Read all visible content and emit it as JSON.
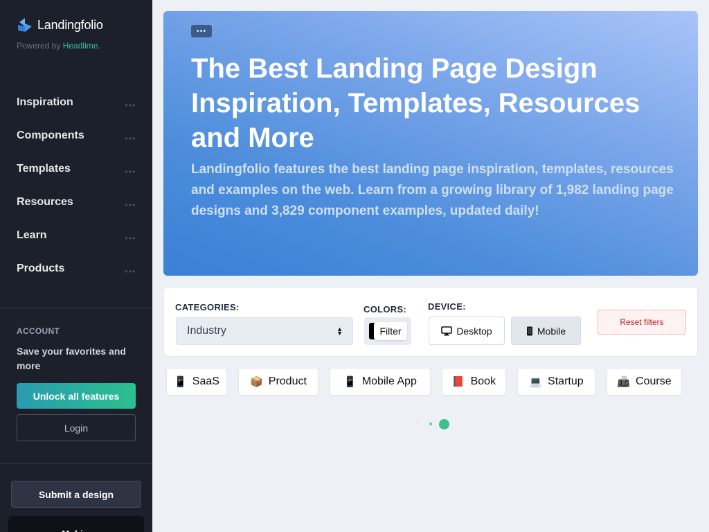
{
  "brand": {
    "name": "Landingfolio",
    "powered_prefix": "Powered by",
    "powered_name": "Headlime."
  },
  "nav": {
    "items": [
      {
        "label": "Inspiration",
        "more": "•••"
      },
      {
        "label": "Components",
        "more": "•••"
      },
      {
        "label": "Templates",
        "more": "•••"
      },
      {
        "label": "Resources",
        "more": "•••"
      },
      {
        "label": "Learn",
        "more": "•••"
      },
      {
        "label": "Products",
        "more": "•••"
      }
    ]
  },
  "account": {
    "title": "ACCOUNT",
    "description": "Save your favorites and more",
    "unlock_label": "Unlock all features",
    "login_label": "Login"
  },
  "submit_label": "Submit a design",
  "sidebar_bottom_label": "Mobi...",
  "hero": {
    "more_label": "•••",
    "title": "The Best Landing Page Design Inspiration, Templates, Resources and More",
    "description": "Landingfolio features the best landing page inspiration, templates, resources and examples on the web. Learn from a growing library of 1,982 landing page designs and 3,829 component examples, updated daily!"
  },
  "filters": {
    "categories_label": "CATEGORIES:",
    "categories_value": "Industry",
    "colors_label": "COLORS:",
    "colors_button": "Filter",
    "device_label": "DEVICE:",
    "device_desktop": "Desktop",
    "device_mobile": "Mobile",
    "reset_label": "Reset filters"
  },
  "chips": [
    {
      "icon": "📱",
      "label": "SaaS"
    },
    {
      "icon": "📦",
      "label": "Product"
    },
    {
      "icon": "📱",
      "label": "Mobile App"
    },
    {
      "icon": "📕",
      "label": "Book"
    },
    {
      "icon": "💻",
      "label": "Startup"
    },
    {
      "icon": "📠",
      "label": "Course"
    }
  ],
  "colors": {
    "sidebar_bg": "#1c202b",
    "accent_green": "#2bc08e",
    "hero_blue": "#4d8ddb",
    "reset_red": "#b91c1c"
  }
}
